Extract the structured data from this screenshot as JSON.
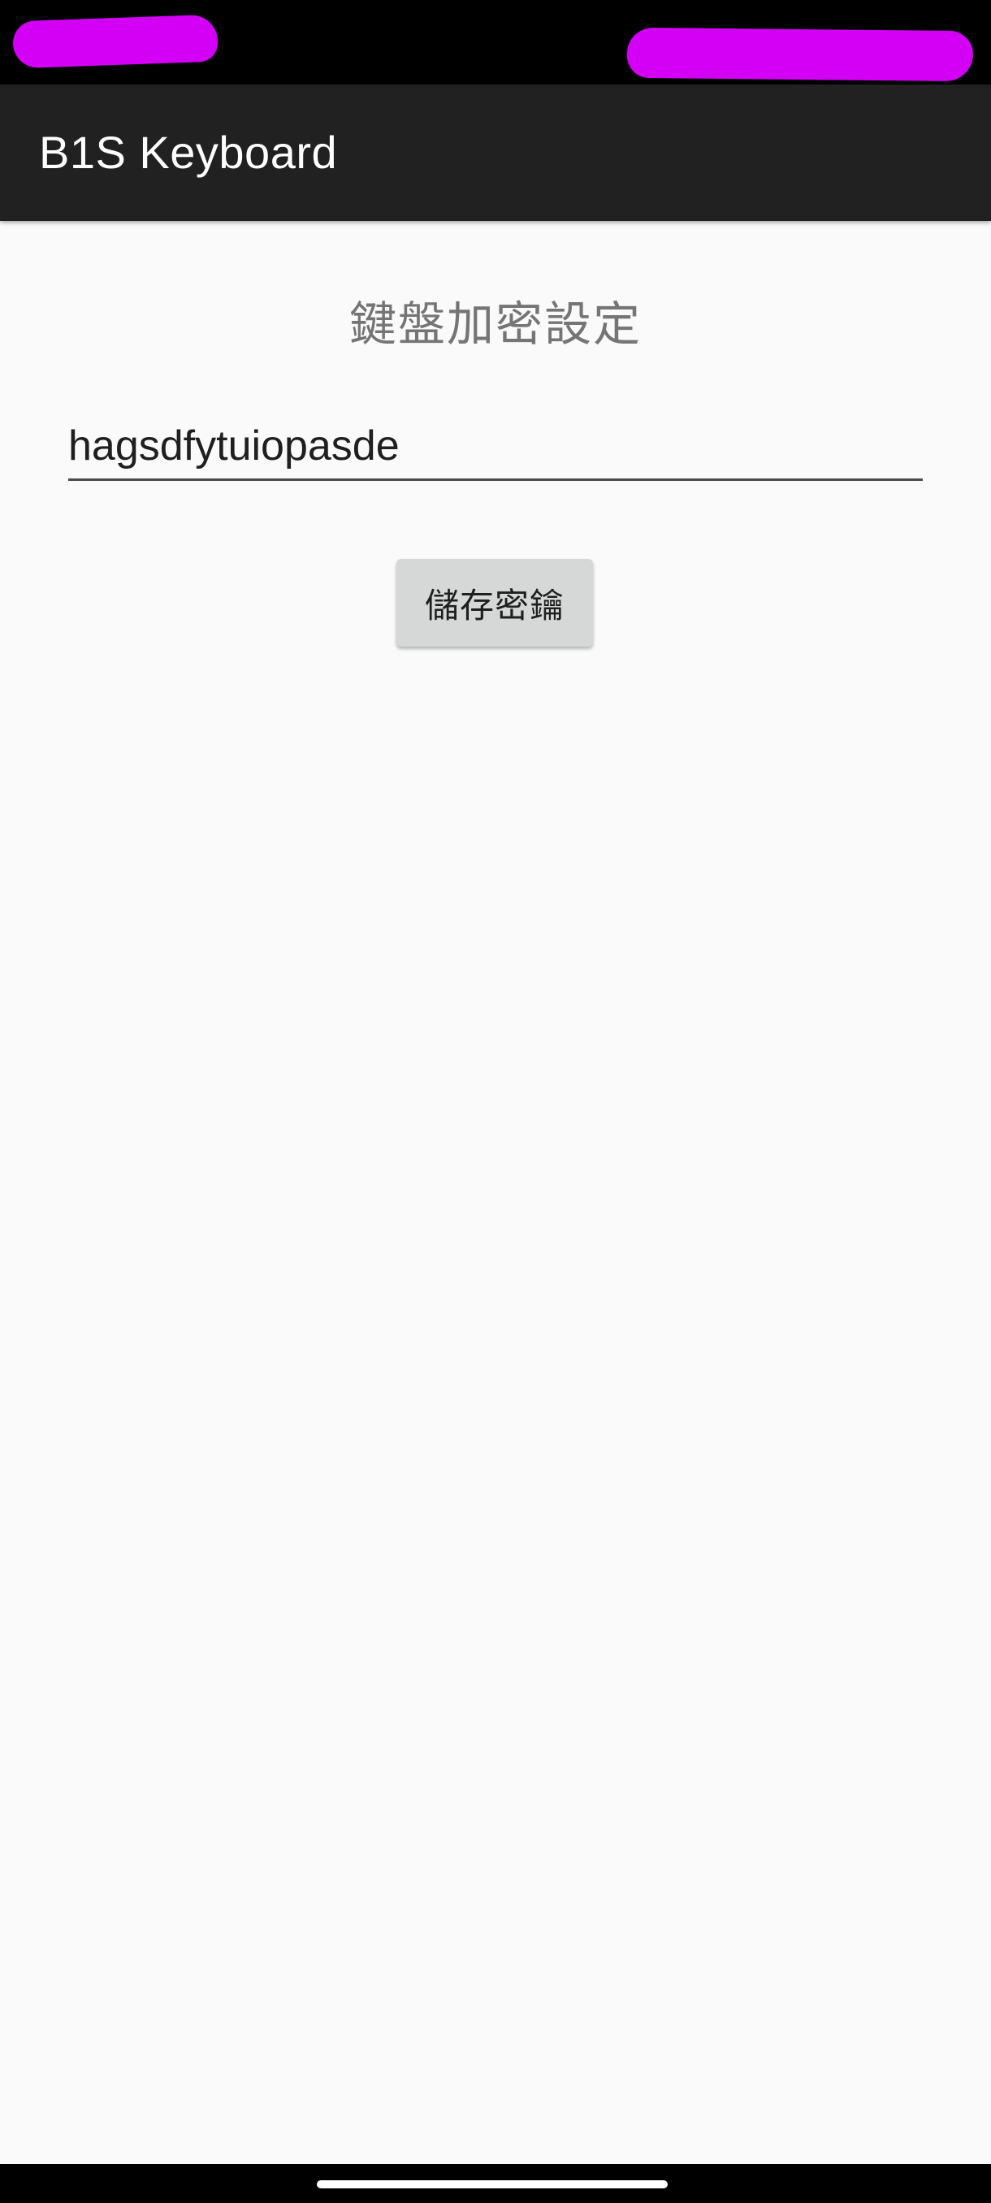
{
  "app": {
    "title": "B1S Keyboard"
  },
  "main": {
    "heading": "鍵盤加密設定",
    "key_input": {
      "value": "hagsdfytuiopasde",
      "placeholder": ""
    },
    "save_button_label": "儲存密鑰"
  },
  "colors": {
    "app_bar": "#212121",
    "status_bar": "#000000",
    "redaction": "#d300f5",
    "background": "#fafafa",
    "button": "#d6d7d7"
  }
}
